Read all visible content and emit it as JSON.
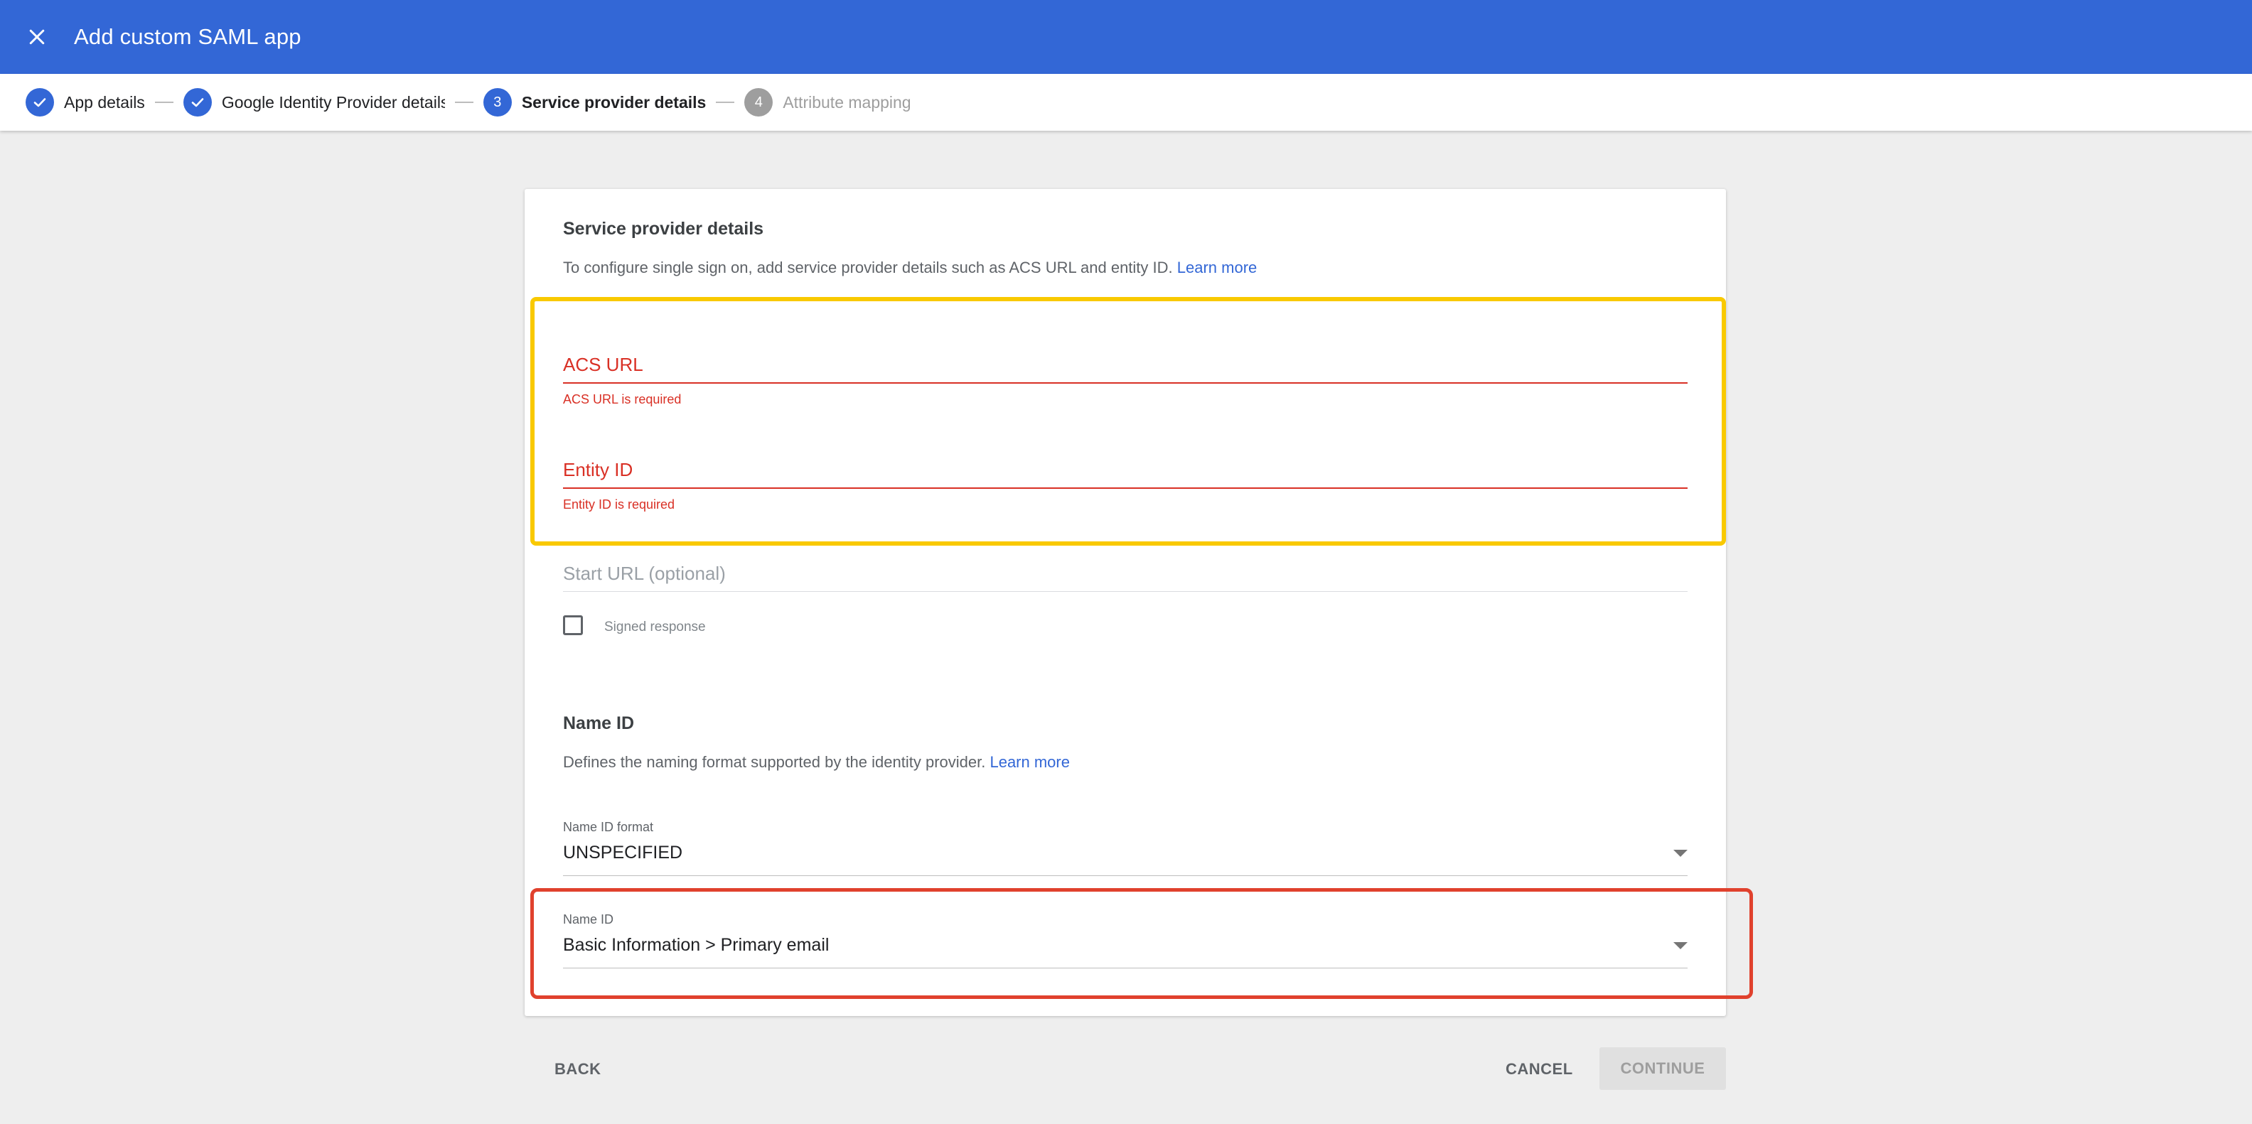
{
  "header": {
    "title": "Add custom SAML app",
    "close_icon": "close-icon"
  },
  "stepper": {
    "steps": [
      {
        "label": "App details",
        "status": "complete"
      },
      {
        "label": "Google Identity Provider details",
        "status": "complete"
      },
      {
        "label": "Service provider details",
        "status": "current",
        "number": "3"
      },
      {
        "label": "Attribute mapping",
        "status": "upcoming",
        "number": "4"
      }
    ]
  },
  "service_provider": {
    "title": "Service provider details",
    "description": "To configure single sign on, add service provider details such as ACS URL and entity ID.",
    "learn_more": "Learn more",
    "acs_url": {
      "label": "ACS URL",
      "value": "",
      "error": "ACS URL is required"
    },
    "entity_id": {
      "label": "Entity ID",
      "value": "",
      "error": "Entity ID is required"
    },
    "start_url": {
      "label": "Start URL (optional)",
      "value": ""
    },
    "signed_response": {
      "label": "Signed response",
      "checked": false
    }
  },
  "name_id": {
    "title": "Name ID",
    "description": "Defines the naming format supported by the identity provider.",
    "learn_more": "Learn more",
    "format": {
      "label": "Name ID format",
      "value": "UNSPECIFIED"
    },
    "name_id_field": {
      "label": "Name ID",
      "value": "Basic Information > Primary email"
    }
  },
  "footer": {
    "back": "BACK",
    "cancel": "CANCEL",
    "continue": "CONTINUE"
  },
  "colors": {
    "primary": "#3367d6",
    "error": "#d93025",
    "highlight_yellow": "#f9c900",
    "highlight_red": "#e0412d"
  }
}
